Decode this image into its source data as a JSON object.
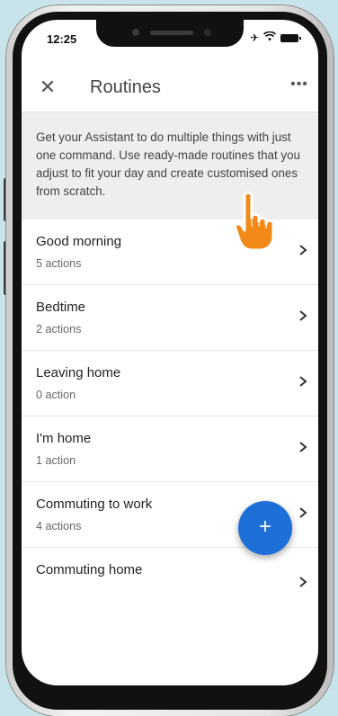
{
  "status": {
    "time": "12:25",
    "icons": [
      "airplane-icon",
      "wifi-icon",
      "battery-icon"
    ]
  },
  "header": {
    "title": "Routines",
    "close_icon": "✕",
    "more_icon": "•••"
  },
  "description": "Get your Assistant to do multiple things with just one command. Use ready-made routines that you adjust to fit your day and create customised ones from scratch.",
  "routines": [
    {
      "name": "Good morning",
      "actions": "5 actions"
    },
    {
      "name": "Bedtime",
      "actions": "2 actions"
    },
    {
      "name": "Leaving home",
      "actions": "0 action"
    },
    {
      "name": "I'm home",
      "actions": "1 action"
    },
    {
      "name": "Commuting to work",
      "actions": "4 actions"
    },
    {
      "name": "Commuting home",
      "actions": ""
    }
  ],
  "fab": {
    "label": "+"
  },
  "colors": {
    "accent": "#1e6fd8",
    "pointer": "#f28a1a",
    "background": "#c9e3ea"
  }
}
